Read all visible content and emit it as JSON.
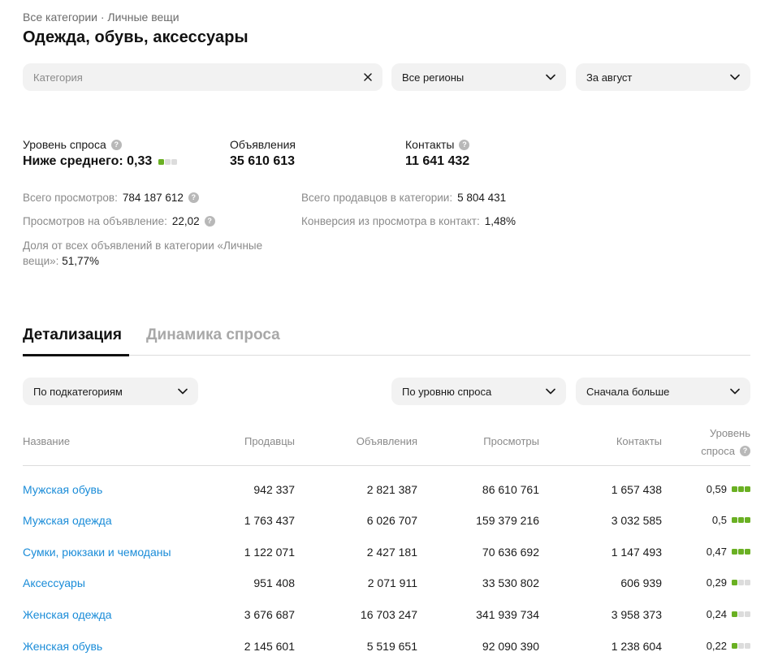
{
  "breadcrumb": "Все категории · Личные вещи",
  "title": "Одежда, обувь, аксессуары",
  "filters": {
    "category_placeholder": "Категория",
    "region": "Все регионы",
    "period": "За август"
  },
  "metrics": {
    "demand_label": "Уровень спроса",
    "demand_value": "Ниже среднего: 0,33",
    "demand_level": 1,
    "ads_label": "Объявления",
    "ads_value": "35 610 613",
    "contacts_label": "Контакты",
    "contacts_value": "11 641 432"
  },
  "stats": {
    "views_label": "Всего просмотров:",
    "views_value": "784 187 612",
    "views_per_ad_label": "Просмотров на объявление:",
    "views_per_ad_value": "22,02",
    "share_label": "Доля от всех объявлений в категории «Личные вещи»:",
    "share_value": "51,77%",
    "sellers_label": "Всего продавцов в категории:",
    "sellers_value": "5 804 431",
    "conversion_label": "Конверсия из просмотра в контакт:",
    "conversion_value": "1,48%"
  },
  "tabs": {
    "details": "Детализация",
    "dynamics": "Динамика спроса"
  },
  "table_filters": {
    "group": "По подкатегориям",
    "sort_by": "По уровню спроса",
    "order": "Сначала больше"
  },
  "table": {
    "headers": {
      "name": "Название",
      "sellers": "Продавцы",
      "ads": "Объявления",
      "views": "Просмотры",
      "contacts": "Контакты",
      "level_1": "Уровень",
      "level_2": "спроса"
    },
    "rows": [
      {
        "name": "Мужская обувь",
        "sellers": "942 337",
        "ads": "2 821 387",
        "views": "86 610 761",
        "contacts": "1 657 438",
        "level": "0,59",
        "dots": 3
      },
      {
        "name": "Мужская одежда",
        "sellers": "1 763 437",
        "ads": "6 026 707",
        "views": "159 379 216",
        "contacts": "3 032 585",
        "level": "0,5",
        "dots": 3
      },
      {
        "name": "Сумки, рюкзаки и чемоданы",
        "sellers": "1 122 071",
        "ads": "2 427 181",
        "views": "70 636 692",
        "contacts": "1 147 493",
        "level": "0,47",
        "dots": 3
      },
      {
        "name": "Аксессуары",
        "sellers": "951 408",
        "ads": "2 071 911",
        "views": "33 530 802",
        "contacts": "606 939",
        "level": "0,29",
        "dots": 1
      },
      {
        "name": "Женская одежда",
        "sellers": "3 676 687",
        "ads": "16 703 247",
        "views": "341 939 734",
        "contacts": "3 958 373",
        "level": "0,24",
        "dots": 1
      },
      {
        "name": "Женская обувь",
        "sellers": "2 145 601",
        "ads": "5 519 651",
        "views": "92 090 390",
        "contacts": "1 238 604",
        "level": "0,22",
        "dots": 1
      }
    ]
  },
  "colors": {
    "link": "#1a8cd8",
    "demand_on": "#6ab023",
    "demand_off": "#dcdcdc"
  },
  "icons": {
    "clear": "close-icon",
    "dropdown": "chevron-down-icon",
    "help": "help-icon"
  }
}
